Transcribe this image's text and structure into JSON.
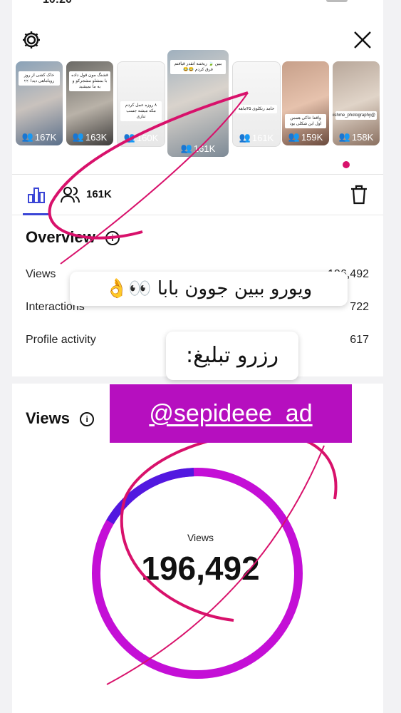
{
  "status_bar": {
    "time": "10:20",
    "battery": "battery"
  },
  "header": {
    "settings_icon": "gear-icon",
    "close_icon": "close-icon"
  },
  "thumbnails": [
    {
      "count": "167K",
      "caption": "خاک کشی از روز رویا‌ماهی دیدا 👀"
    },
    {
      "count": "163K",
      "caption": "قشنگ مون قول داده با بمشلو مشجرکو و به ما نمیشید"
    },
    {
      "count": "160K",
      "caption": "۸ روزه عمل کردم مکه میشه جسب تنازی"
    },
    {
      "count": "161K",
      "caption": "ببین 🍃 ریختنه اتقدر قیافتم فرق کردم 😂😂",
      "selected": true
    },
    {
      "count": "161K",
      "caption": "حامد رنکلوی ۳۵ماهه"
    },
    {
      "count": "159K",
      "caption": "واقعا خاکی هممن اول این شکلی بود"
    },
    {
      "count": "158K",
      "caption": "@tanishme_photography"
    }
  ],
  "tabs": {
    "chart_icon": "bar-chart-icon",
    "audience_icon": "people-icon",
    "audience_count": "161K",
    "delete_icon": "trash-icon"
  },
  "overview": {
    "title": "Overview",
    "rows": [
      {
        "label": "Views",
        "value": "196,492"
      },
      {
        "label": "Interactions",
        "value": "722"
      },
      {
        "label": "Profile activity",
        "value": "617"
      }
    ]
  },
  "stickers": {
    "sticker_one": "ویورو ببین جوون بابا 👀👌",
    "sticker_two": "رزرو تبلیغ:",
    "ad_handle": "@sepideee_ad"
  },
  "views_section": {
    "title": "Views",
    "donut_label": "Views",
    "donut_value": "196,492",
    "colors": {
      "followers": "#5218e0",
      "non_followers": "#c40fd6"
    },
    "followers_fraction": 0.16
  }
}
